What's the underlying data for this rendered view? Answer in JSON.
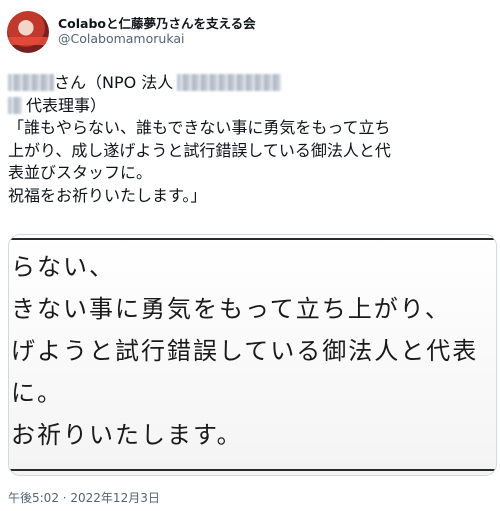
{
  "author": {
    "display_name": "Colaboと仁藤夢乃さんを支える会",
    "handle": "@Colabomamorukai"
  },
  "tweet": {
    "line1_suffix": "さん（NPO 法人",
    "line2_suffix": "代表理事）",
    "quote_lines": [
      "「誰もやらない、誰もできない事に勇気をもって立ち",
      "上がり、成し遂げようと試行錯誤している御法人と代",
      "表並びスタッフに。",
      "祝福をお祈りいたします。」"
    ]
  },
  "image": {
    "excerpt_lines": [
      "らない、",
      "きない事に勇気をもって立ち上がり、",
      "げようと試行錯誤している御法人と代表",
      "に。",
      "お祈りいたします。"
    ]
  },
  "timestamp": "午後5:02 · 2022年12月3日"
}
